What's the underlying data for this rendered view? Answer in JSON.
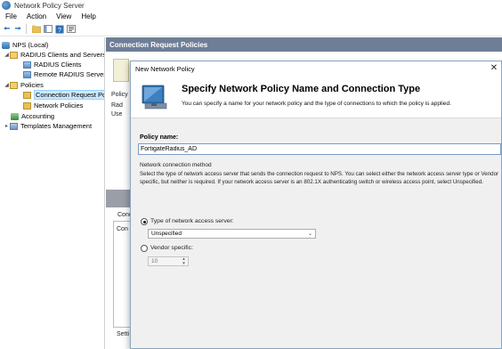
{
  "window": {
    "title": "Network Policy Server"
  },
  "menu": [
    "File",
    "Action",
    "View",
    "Help"
  ],
  "tree": {
    "items": [
      {
        "label": "NPS (Local)"
      },
      {
        "label": "RADIUS Clients and Servers"
      },
      {
        "label": "RADIUS Clients"
      },
      {
        "label": "Remote RADIUS Server"
      },
      {
        "label": "Policies"
      },
      {
        "label": "Connection Request Po"
      },
      {
        "label": "Network Policies"
      },
      {
        "label": "Accounting"
      },
      {
        "label": "Templates Management"
      }
    ]
  },
  "pane": {
    "header": "Connection Request Policies",
    "policy_label": "Policy N",
    "item1": "Rad",
    "item2": "Use",
    "conditions_label": "Conc",
    "conditions_item": "Con",
    "settings_label": "Setti"
  },
  "dialog": {
    "title": "New Network Policy",
    "heading": "Specify Network Policy Name and Connection Type",
    "subtitle": "You can specify a name for your network policy and the type of connections to which the policy is applied.",
    "policy_name_label": "Policy name:",
    "policy_name_value": "FortigateRadius_AD",
    "nc_method_label": "Network connection method",
    "nc_description": "Select the type of network access server that sends the connection request to NPS. You can select either the network access server type or Vendor specific, but neither is required.  If your network access server is an 802.1X authenticating switch or wireless access point, select Unspecified.",
    "type_nas_label": "Type of network access server:",
    "type_nas_value": "Unspecified",
    "vendor_specific_label": "Vendor specific:",
    "vendor_specific_value": "10"
  }
}
